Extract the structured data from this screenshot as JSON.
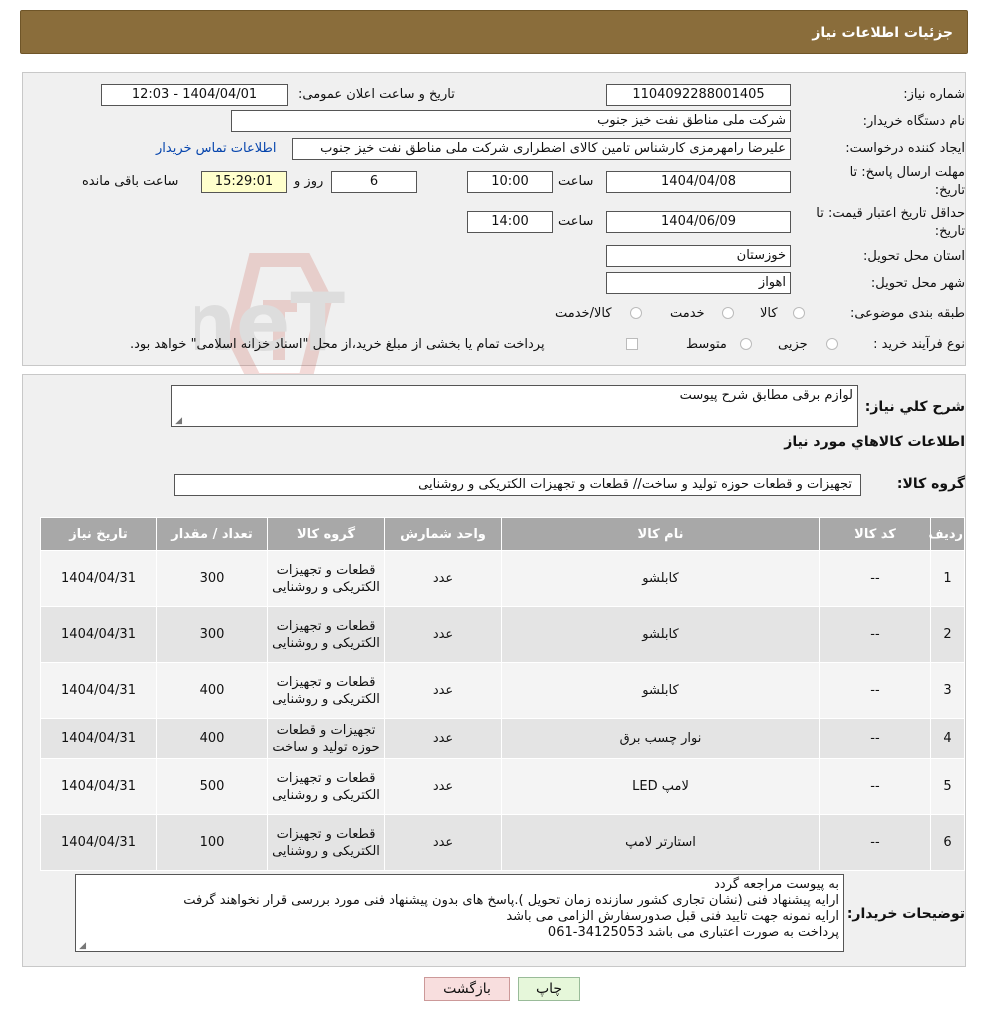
{
  "header": {
    "title": "جزئیات اطلاعات نیاز"
  },
  "form": {
    "need_number_label": "شماره نیاز:",
    "need_number": "1104092288001405",
    "announce_label": "تاریخ و ساعت اعلان عمومی:",
    "announce_value": "1404/04/01 - 12:03",
    "buyer_label": "نام دستگاه خریدار:",
    "buyer_value": "شرکت ملی مناطق نفت خیز جنوب",
    "creator_label": "ایجاد کننده درخواست:",
    "creator_value": "علیرضا رامهرمزی کارشناس تامین کالای اضطراری شرکت ملی مناطق نفت خیز جنوب",
    "contact_link": "اطلاعات تماس خریدار",
    "deadline_label_1": "مهلت ارسال پاسخ: تا",
    "deadline_label_2": "تاریخ:",
    "deadline_date": "1404/04/08",
    "time_label": "ساعت",
    "deadline_time": "10:00",
    "days_value": "6",
    "days_label": "روز و",
    "remaining_time": "15:29:01",
    "remaining_label": "ساعت باقی مانده",
    "validity_label_1": "حداقل تاریخ اعتبار قیمت: تا",
    "validity_label_2": "تاریخ:",
    "validity_date": "1404/06/09",
    "validity_time": "14:00",
    "province_label": "استان محل تحویل:",
    "province_value": "خوزستان",
    "city_label": "شهر محل تحویل:",
    "city_value": "اهواز",
    "category_label": "طبقه بندی موضوعی:",
    "category_options": [
      "کالا",
      "خدمت",
      "کالا/خدمت"
    ],
    "process_label": "نوع فرآیند خرید :",
    "process_options": [
      "جزیی",
      "متوسط"
    ],
    "payment_note": "پرداخت تمام یا بخشی از مبلغ خرید،از محل \"اسناد خزانه اسلامی\" خواهد بود."
  },
  "summary": {
    "description_label": "شرح کلي نياز:",
    "description_value": "لوازم برقی مطابق شرح پیوست",
    "items_title": "اطلاعات کالاهاي مورد نياز",
    "group_label": "گروه کالا:",
    "group_value": "تجهیزات و قطعات حوزه تولید و ساخت// قطعات و تجهیزات الکتریکی و روشنایی"
  },
  "table": {
    "headers": [
      "رديف",
      "کد کالا",
      "نام کالا",
      "واحد شمارش",
      "گروه کالا",
      "تعداد / مقدار",
      "تاریخ نیاز"
    ],
    "rows": [
      [
        "1",
        "--",
        "کابلشو",
        "عدد",
        "قطعات و تجهیزات الکتریکی و روشنایی",
        "300",
        "1404/04/31"
      ],
      [
        "2",
        "--",
        "کابلشو",
        "عدد",
        "قطعات و تجهیزات الکتریکی و روشنایی",
        "300",
        "1404/04/31"
      ],
      [
        "3",
        "--",
        "کابلشو",
        "عدد",
        "قطعات و تجهیزات الکتریکی و روشنایی",
        "400",
        "1404/04/31"
      ],
      [
        "4",
        "--",
        "نوار چسب برق",
        "عدد",
        "تجهیزات و قطعات حوزه تولید و ساخت",
        "400",
        "1404/04/31"
      ],
      [
        "5",
        "--",
        "لامپ LED",
        "عدد",
        "قطعات و تجهیزات الکتریکی و روشنایی",
        "500",
        "1404/04/31"
      ],
      [
        "6",
        "--",
        "استارتر لامپ",
        "عدد",
        "قطعات و تجهیزات الکتریکی و روشنایی",
        "100",
        "1404/04/31"
      ]
    ]
  },
  "notes": {
    "label": "توضیحات خریدار:",
    "lines": [
      "به پیوست مراجعه گردد",
      "ارایه پیشنهاد فنی (نشان تجاری کشور سازنده زمان تحویل ).پاسخ های بدون پیشنهاد فنی مورد بررسی قرار نخواهند گرفت",
      "ارایه نمونه جهت تایید فنی قبل صدورسفارش الزامی می باشد",
      "پرداخت به صورت اعتباری می باشد 34125053-061"
    ]
  },
  "buttons": {
    "print": "چاپ",
    "back": "بازگشت"
  },
  "watermark": {
    "text": "AriaTender.neT"
  },
  "colors": {
    "header_bg": "#8a6d3b",
    "table_header_bg": "#a8a8a8",
    "link": "#0645ad"
  }
}
